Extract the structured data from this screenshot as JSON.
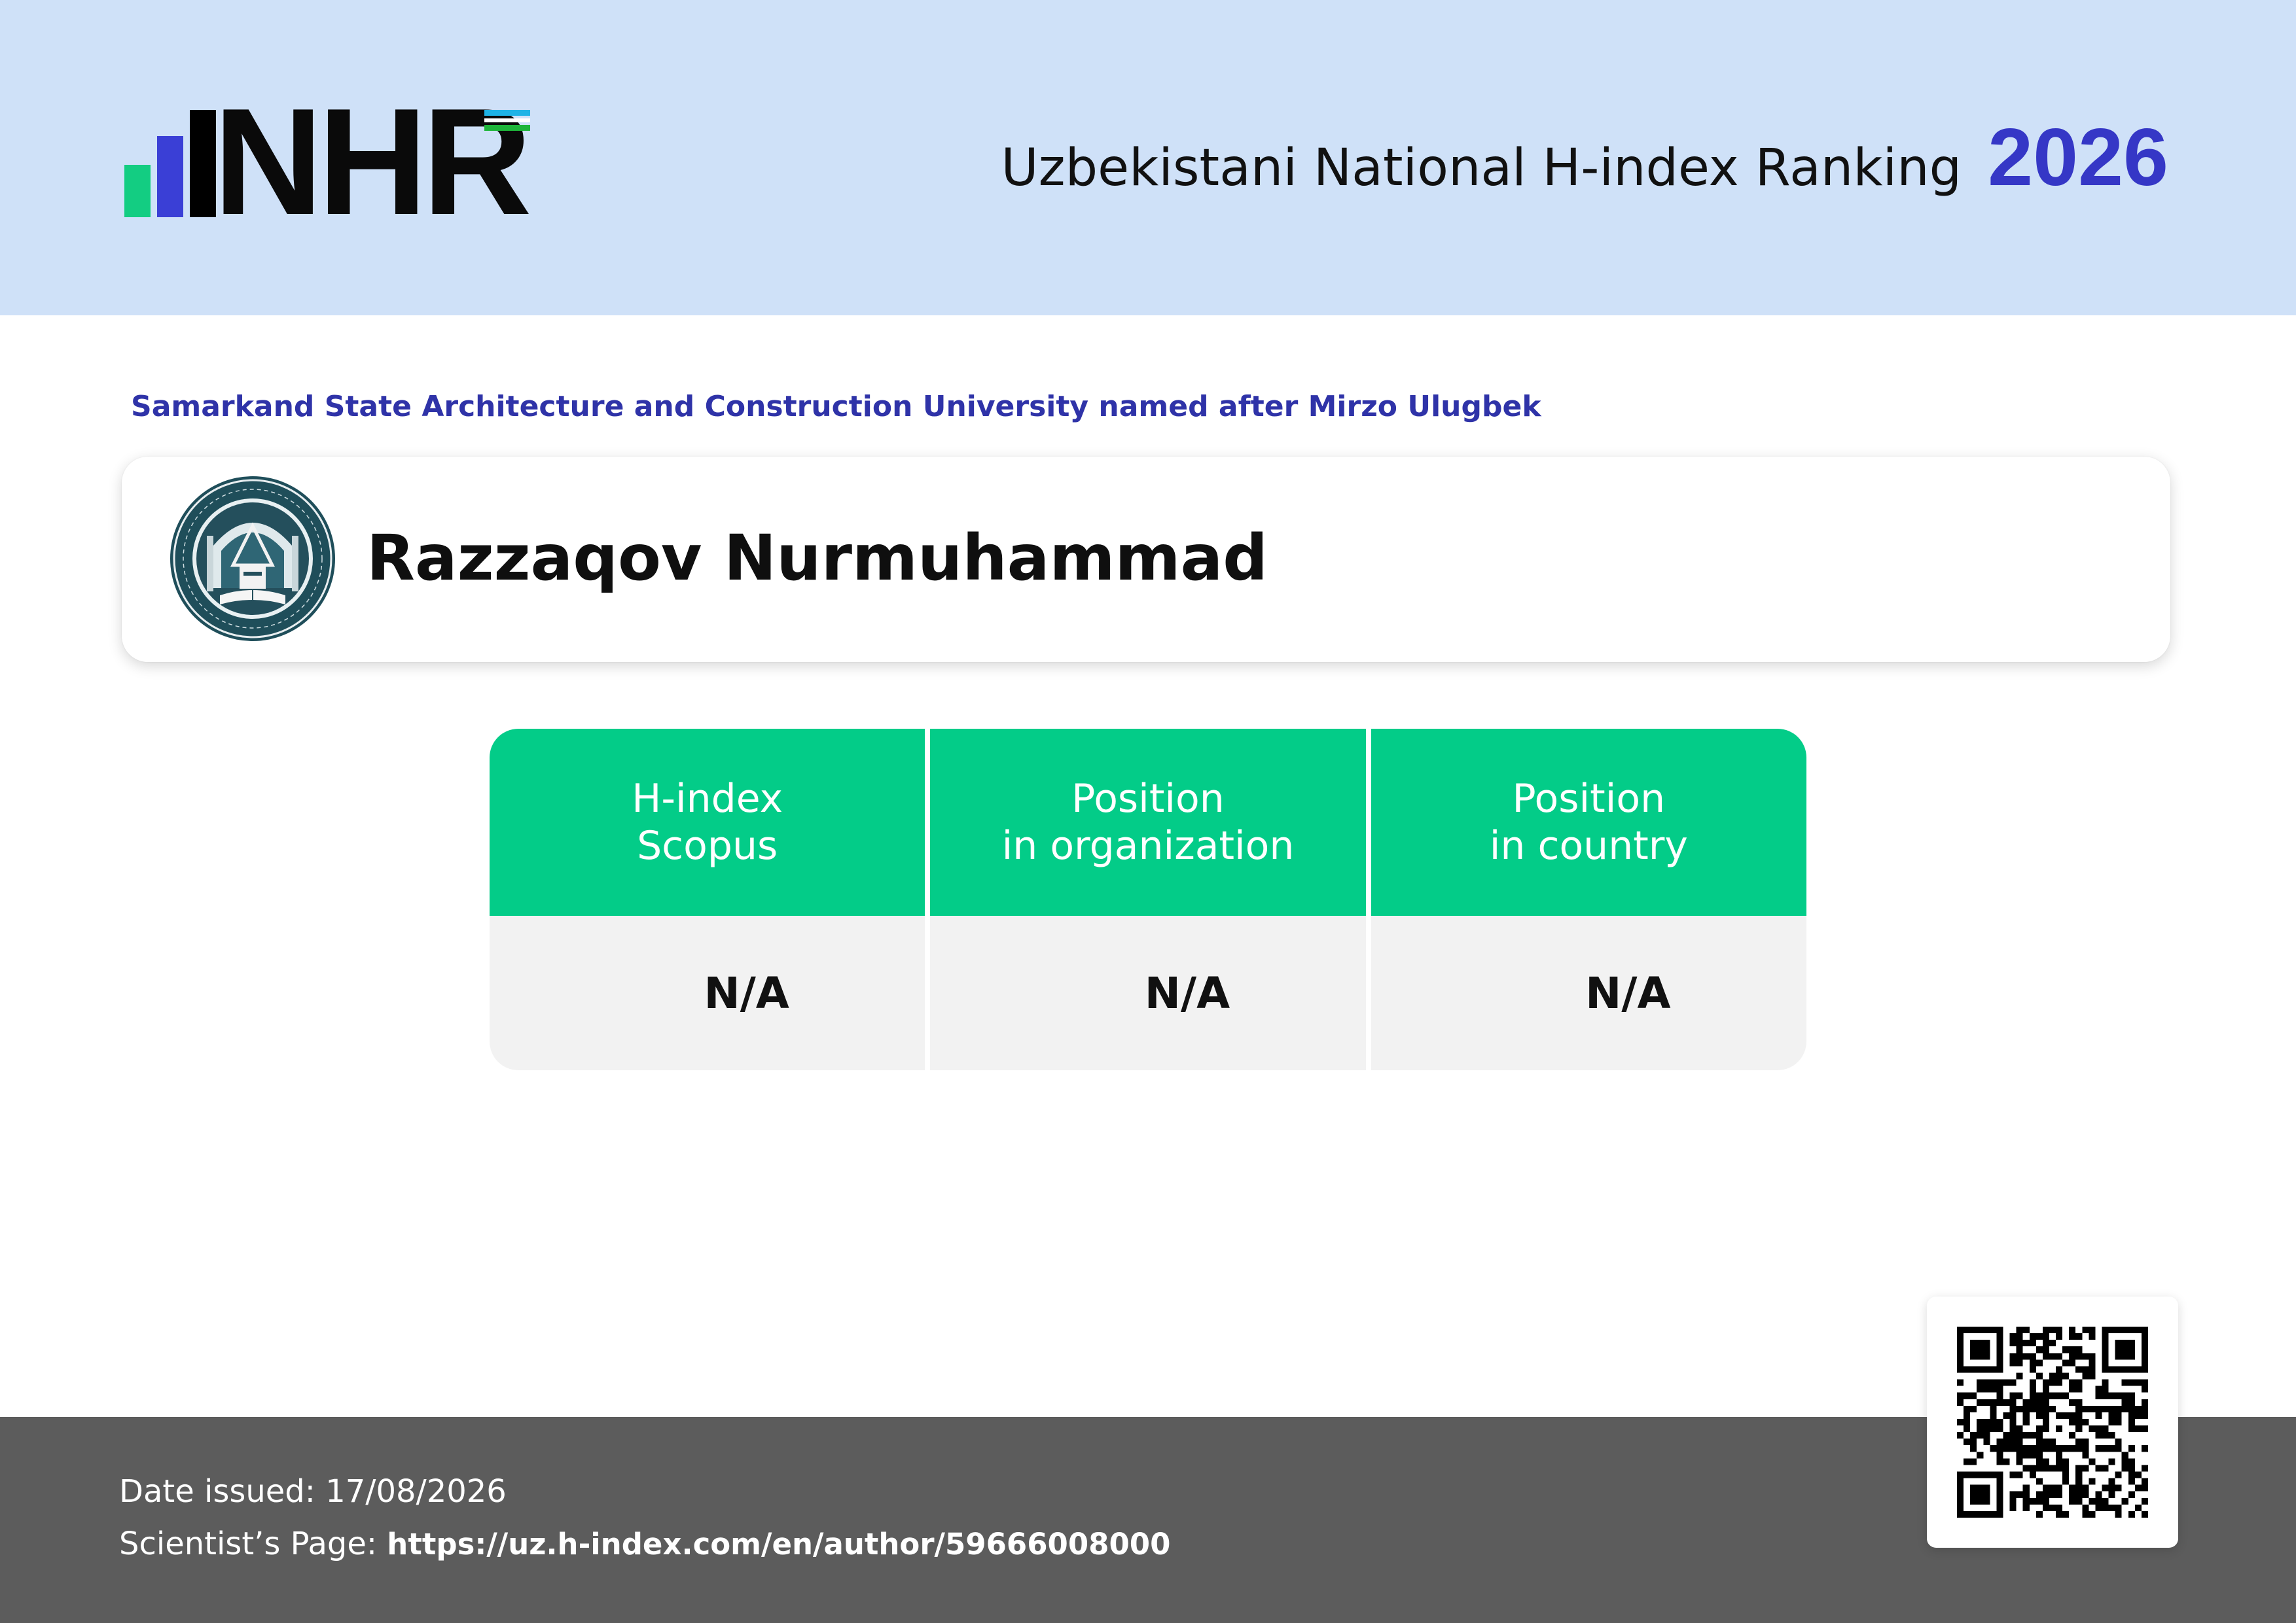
{
  "header": {
    "logo_text": "NHR",
    "title": "Uzbekistani National H-index Ranking",
    "year": "2026",
    "flag_colors": [
      "#1eb3e6",
      "#ffffff",
      "#1eb53a"
    ]
  },
  "organization": "Samarkand State Architecture and Construction University named after Mirzo Ulugbek",
  "person": {
    "name": "Razzaqov Nurmuhammad"
  },
  "stats": {
    "h_index": {
      "label_line1": "H-index",
      "label_line2": "Scopus",
      "value": "N/A"
    },
    "org_position": {
      "label_line1": "Position",
      "label_line2": "in organization",
      "value": "N/A"
    },
    "country_position": {
      "label_line1": "Position",
      "label_line2": "in country",
      "value": "N/A"
    }
  },
  "footer": {
    "date_label": "Date issued: 17/08/2026",
    "page_label": "Scientist’s Page:",
    "page_url": "https://uz.h-index.com/en/author/59666008000"
  },
  "colors": {
    "header_bg": "#cfe1f8",
    "accent_blue": "#3537c6",
    "accent_green": "#03cc88",
    "footer_bg": "#5c5c5c"
  },
  "icons": {
    "emblem": "university-seal-icon",
    "qr": "qr-code-icon"
  }
}
